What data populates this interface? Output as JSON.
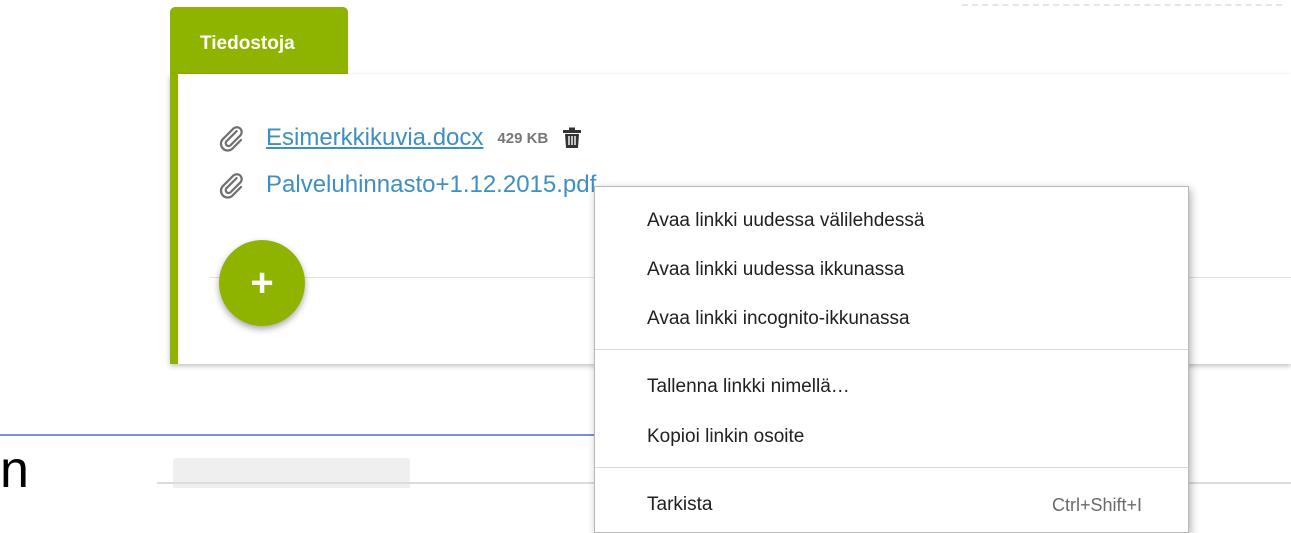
{
  "panel": {
    "tab_label": "Tiedostoja",
    "files": [
      {
        "name": "Esimerkkikuvia.docx",
        "size": "429 KB"
      },
      {
        "name": "Palveluhinnasto+1.12.2015.pdf",
        "size": ""
      }
    ],
    "add_button": "+"
  },
  "annotation": {
    "text": "n",
    "arrow_color": "#4a6fc4"
  },
  "context_menu": {
    "items": [
      "Avaa linkki uudessa välilehdessä",
      "Avaa linkki uudessa ikkunassa",
      "Avaa linkki incognito-ikkunassa",
      "Tallenna linkki nimellä…",
      "Kopioi linkin osoite",
      "Tarkista"
    ],
    "inspect_shortcut": "Ctrl+Shift+I"
  },
  "colors": {
    "accent_green": "#8fb400",
    "link_blue": "#3f8fc0"
  }
}
